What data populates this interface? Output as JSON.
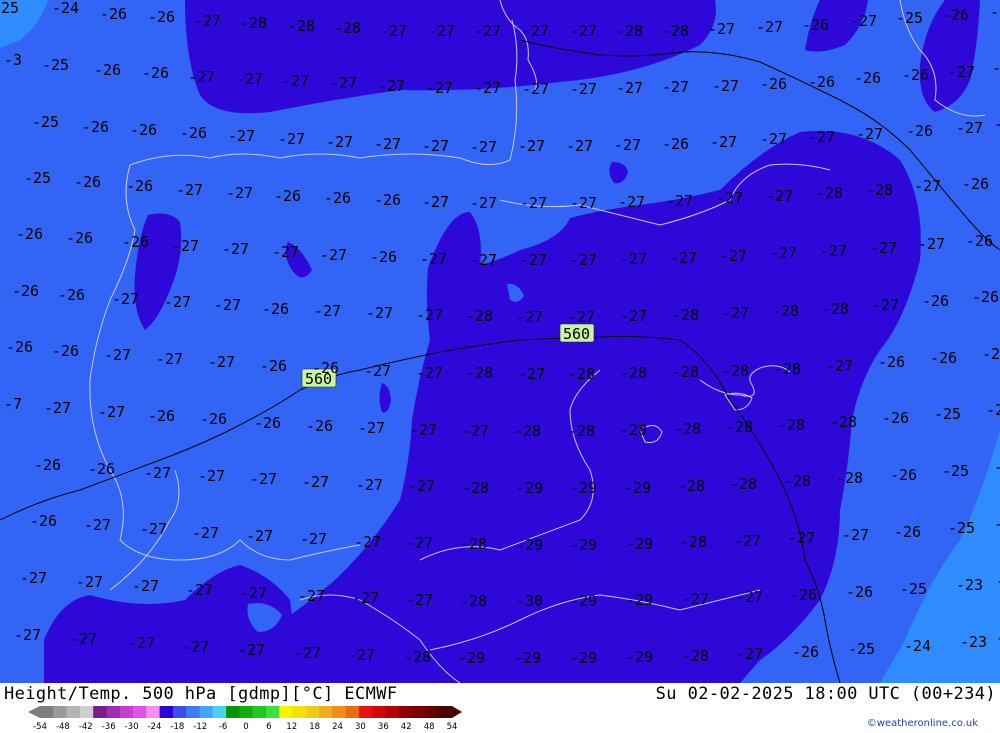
{
  "title": "Height/Temp. 500 hPa [gdmp][°C] ECMWF",
  "datetime": "Su 02-02-2025 18:00 UTC (00+234)",
  "credit": "©weatheronline.co.uk",
  "contour_labels": [
    "560",
    "560"
  ],
  "colors": {
    "ocean_light": "#2f8cff",
    "medium_blue": "#3264f5",
    "dark_blue": "#2e08d8",
    "border": "#000000",
    "coast": "#c8c8ff",
    "highlight": "#c8f5a0"
  },
  "scale": {
    "labels": [
      "-54",
      "-48",
      "-42",
      "-36",
      "-30",
      "-24",
      "-18",
      "-12",
      "-6",
      "0",
      "6",
      "12",
      "18",
      "24",
      "30",
      "36",
      "42",
      "48",
      "54"
    ],
    "colors": [
      "#7e7e7e",
      "#9a9a9a",
      "#b4b4b4",
      "#cfcfcf",
      "#7a1f8a",
      "#9e2cb0",
      "#c43fd0",
      "#e055e8",
      "#f490f5",
      "#2d07d6",
      "#3a4bf0",
      "#3d7cf5",
      "#45a6f7",
      "#48d4f0",
      "#049404",
      "#10ae10",
      "#20c820",
      "#3ee03e",
      "#f5f500",
      "#f5e20a",
      "#f2c81a",
      "#f0ad1a",
      "#ec8f14",
      "#e86d0e",
      "#e81010",
      "#cc0808",
      "#b00404",
      "#940000",
      "#7c0000",
      "#640000",
      "#480000"
    ]
  },
  "temperature_labels": [
    [
      "-25",
      -8,
      8
    ],
    [
      "-24",
      52,
      8
    ],
    [
      "-26",
      100,
      14
    ],
    [
      "-26",
      148,
      17
    ],
    [
      "-27",
      194,
      21
    ],
    [
      "-28",
      240,
      23
    ],
    [
      "-28",
      288,
      26
    ],
    [
      "-28",
      334,
      28
    ],
    [
      "-27",
      380,
      31
    ],
    [
      "-27",
      428,
      31
    ],
    [
      "-27",
      474,
      31
    ],
    [
      "-27",
      522,
      31
    ],
    [
      "-27",
      570,
      31
    ],
    [
      "-28",
      616,
      31
    ],
    [
      "-28",
      662,
      31
    ],
    [
      "-27",
      708,
      29
    ],
    [
      "-27",
      756,
      27
    ],
    [
      "-26",
      802,
      25
    ],
    [
      "-27",
      850,
      21
    ],
    [
      "-25",
      896,
      18
    ],
    [
      "-26",
      942,
      15
    ],
    [
      "-27",
      990,
      12
    ],
    [
      "-3",
      4,
      60
    ],
    [
      "-25",
      42,
      65
    ],
    [
      "-26",
      94,
      70
    ],
    [
      "-26",
      142,
      73
    ],
    [
      "-27",
      188,
      77
    ],
    [
      "-27",
      236,
      79
    ],
    [
      "-27",
      282,
      81
    ],
    [
      "-27",
      330,
      83
    ],
    [
      "-27",
      378,
      86
    ],
    [
      "-27",
      426,
      88
    ],
    [
      "-27",
      474,
      88
    ],
    [
      "-27",
      522,
      89
    ],
    [
      "-27",
      570,
      89
    ],
    [
      "-27",
      616,
      88
    ],
    [
      "-27",
      662,
      87
    ],
    [
      "-27",
      712,
      86
    ],
    [
      "-26",
      760,
      84
    ],
    [
      "-26",
      808,
      82
    ],
    [
      "-26",
      854,
      78
    ],
    [
      "-26",
      902,
      75
    ],
    [
      "-27",
      948,
      72
    ],
    [
      "-2",
      992,
      68
    ],
    [
      "-25",
      32,
      122
    ],
    [
      "-26",
      82,
      127
    ],
    [
      "-26",
      130,
      130
    ],
    [
      "-26",
      180,
      133
    ],
    [
      "-27",
      228,
      136
    ],
    [
      "-27",
      278,
      139
    ],
    [
      "-27",
      326,
      142
    ],
    [
      "-27",
      374,
      144
    ],
    [
      "-27",
      422,
      146
    ],
    [
      "-27",
      470,
      147
    ],
    [
      "-27",
      518,
      146
    ],
    [
      "-27",
      566,
      146
    ],
    [
      "-27",
      614,
      145
    ],
    [
      "-26",
      662,
      144
    ],
    [
      "-27",
      710,
      142
    ],
    [
      "-27",
      760,
      139
    ],
    [
      "-27",
      808,
      137
    ],
    [
      "-27",
      856,
      134
    ],
    [
      "-26",
      906,
      131
    ],
    [
      "-27",
      956,
      128
    ],
    [
      "-2",
      994,
      124
    ],
    [
      "-25",
      24,
      178
    ],
    [
      "-26",
      74,
      182
    ],
    [
      "-26",
      126,
      186
    ],
    [
      "-27",
      176,
      190
    ],
    [
      "-27",
      226,
      193
    ],
    [
      "-26",
      274,
      196
    ],
    [
      "-26",
      324,
      198
    ],
    [
      "-26",
      374,
      200
    ],
    [
      "-27",
      422,
      202
    ],
    [
      "-27",
      470,
      203
    ],
    [
      "-27",
      520,
      203
    ],
    [
      "-27",
      570,
      203
    ],
    [
      "-27",
      618,
      202
    ],
    [
      "-27",
      666,
      201
    ],
    [
      "-27",
      716,
      198
    ],
    [
      "-27",
      766,
      196
    ],
    [
      "-28",
      816,
      193
    ],
    [
      "-28",
      866,
      190
    ],
    [
      "-27",
      914,
      186
    ],
    [
      "-26",
      962,
      184
    ],
    [
      "-26",
      16,
      234
    ],
    [
      "-26",
      66,
      238
    ],
    [
      "-26",
      122,
      242
    ],
    [
      "-27",
      172,
      246
    ],
    [
      "-27",
      222,
      249
    ],
    [
      "-27",
      272,
      252
    ],
    [
      "-27",
      320,
      255
    ],
    [
      "-26",
      370,
      257
    ],
    [
      "-27",
      420,
      259
    ],
    [
      "-27",
      470,
      260
    ],
    [
      "-27",
      520,
      260
    ],
    [
      "-27",
      570,
      260
    ],
    [
      "-27",
      620,
      259
    ],
    [
      "-27",
      670,
      258
    ],
    [
      "-27",
      720,
      256
    ],
    [
      "-27",
      770,
      253
    ],
    [
      "-27",
      820,
      251
    ],
    [
      "-27",
      870,
      248
    ],
    [
      "-27",
      918,
      244
    ],
    [
      "-26",
      966,
      241
    ],
    [
      "-26",
      12,
      291
    ],
    [
      "-26",
      58,
      295
    ],
    [
      "-27",
      112,
      299
    ],
    [
      "-27",
      164,
      302
    ],
    [
      "-27",
      214,
      305
    ],
    [
      "-26",
      262,
      309
    ],
    [
      "-27",
      314,
      311
    ],
    [
      "-27",
      366,
      313
    ],
    [
      "-27",
      416,
      315
    ],
    [
      "-28",
      466,
      316
    ],
    [
      "-27",
      516,
      317
    ],
    [
      "-27",
      568,
      317
    ],
    [
      "-27",
      620,
      316
    ],
    [
      "-28",
      672,
      315
    ],
    [
      "-27",
      722,
      313
    ],
    [
      "-28",
      772,
      311
    ],
    [
      "-28",
      822,
      309
    ],
    [
      "-27",
      872,
      305
    ],
    [
      "-26",
      922,
      301
    ],
    [
      "-26",
      972,
      297
    ],
    [
      "-26",
      6,
      347
    ],
    [
      "-26",
      52,
      351
    ],
    [
      "-27",
      104,
      355
    ],
    [
      "-27",
      156,
      359
    ],
    [
      "-27",
      208,
      362
    ],
    [
      "-26",
      260,
      366
    ],
    [
      "-26",
      312,
      368
    ],
    [
      "-27",
      364,
      371
    ],
    [
      "-27",
      416,
      373
    ],
    [
      "-28",
      466,
      373
    ],
    [
      "-27",
      518,
      374
    ],
    [
      "-28",
      568,
      374
    ],
    [
      "-28",
      620,
      373
    ],
    [
      "-28",
      672,
      372
    ],
    [
      "-28",
      722,
      371
    ],
    [
      "-28",
      774,
      369
    ],
    [
      "-27",
      826,
      366
    ],
    [
      "-26",
      878,
      362
    ],
    [
      "-26",
      930,
      358
    ],
    [
      "-25",
      982,
      354
    ],
    [
      "-7",
      4,
      404
    ],
    [
      "-27",
      44,
      408
    ],
    [
      "-27",
      98,
      412
    ],
    [
      "-26",
      148,
      416
    ],
    [
      "-26",
      200,
      419
    ],
    [
      "-26",
      254,
      423
    ],
    [
      "-26",
      306,
      426
    ],
    [
      "-27",
      358,
      428
    ],
    [
      "-27",
      410,
      430
    ],
    [
      "-27",
      462,
      431
    ],
    [
      "-28",
      514,
      431
    ],
    [
      "-28",
      568,
      431
    ],
    [
      "-28",
      620,
      430
    ],
    [
      "-28",
      674,
      429
    ],
    [
      "-28",
      726,
      427
    ],
    [
      "-28",
      778,
      425
    ],
    [
      "-28",
      830,
      422
    ],
    [
      "-26",
      882,
      418
    ],
    [
      "-25",
      934,
      414
    ],
    [
      "-24",
      986,
      410
    ],
    [
      "-26",
      34,
      465
    ],
    [
      "-26",
      88,
      469
    ],
    [
      "-27",
      144,
      473
    ],
    [
      "-27",
      198,
      476
    ],
    [
      "-27",
      250,
      479
    ],
    [
      "-27",
      302,
      482
    ],
    [
      "-27",
      356,
      485
    ],
    [
      "-27",
      408,
      486
    ],
    [
      "-28",
      462,
      488
    ],
    [
      "-29",
      516,
      488
    ],
    [
      "-29",
      570,
      488
    ],
    [
      "-29",
      624,
      488
    ],
    [
      "-28",
      678,
      486
    ],
    [
      "-28",
      730,
      484
    ],
    [
      "-28",
      784,
      481
    ],
    [
      "-28",
      836,
      478
    ],
    [
      "-26",
      890,
      475
    ],
    [
      "-25",
      942,
      471
    ],
    [
      "-2",
      994,
      467
    ],
    [
      "-26",
      30,
      521
    ],
    [
      "-27",
      84,
      525
    ],
    [
      "-27",
      140,
      529
    ],
    [
      "-27",
      192,
      533
    ],
    [
      "-27",
      246,
      536
    ],
    [
      "-27",
      300,
      539
    ],
    [
      "-27",
      354,
      542
    ],
    [
      "-27",
      406,
      543
    ],
    [
      "-28",
      460,
      544
    ],
    [
      "-29",
      516,
      545
    ],
    [
      "-29",
      570,
      545
    ],
    [
      "-29",
      626,
      544
    ],
    [
      "-28",
      680,
      542
    ],
    [
      "-27",
      734,
      541
    ],
    [
      "-27",
      788,
      538
    ],
    [
      "-27",
      842,
      535
    ],
    [
      "-26",
      894,
      532
    ],
    [
      "-25",
      948,
      528
    ],
    [
      "-2",
      994,
      524
    ],
    [
      "-27",
      20,
      578
    ],
    [
      "-27",
      76,
      582
    ],
    [
      "-27",
      132,
      586
    ],
    [
      "-27",
      186,
      590
    ],
    [
      "-27",
      240,
      593
    ],
    [
      "-27",
      298,
      596
    ],
    [
      "-27",
      352,
      598
    ],
    [
      "-27",
      406,
      600
    ],
    [
      "-28",
      460,
      601
    ],
    [
      "-30",
      516,
      601
    ],
    [
      "-29",
      570,
      601
    ],
    [
      "-29",
      626,
      600
    ],
    [
      "-27",
      682,
      599
    ],
    [
      "-27",
      736,
      597
    ],
    [
      "-26",
      790,
      595
    ],
    [
      "-26",
      846,
      592
    ],
    [
      "-25",
      900,
      589
    ],
    [
      "-23",
      956,
      585
    ],
    [
      "-2",
      996,
      581
    ],
    [
      "-27",
      14,
      635
    ],
    [
      "-27",
      70,
      639
    ],
    [
      "-27",
      128,
      643
    ],
    [
      "-27",
      182,
      647
    ],
    [
      "-27",
      238,
      650
    ],
    [
      "-27",
      294,
      653
    ],
    [
      "-27",
      348,
      655
    ],
    [
      "-28",
      404,
      657
    ],
    [
      "-29",
      458,
      658
    ],
    [
      "-29",
      514,
      658
    ],
    [
      "-29",
      570,
      658
    ],
    [
      "-29",
      626,
      657
    ],
    [
      "-28",
      682,
      656
    ],
    [
      "-27",
      736,
      654
    ],
    [
      "-26",
      792,
      652
    ],
    [
      "-25",
      848,
      649
    ],
    [
      "-24",
      904,
      646
    ],
    [
      "-23",
      960,
      642
    ],
    [
      "-2",
      996,
      638
    ]
  ]
}
